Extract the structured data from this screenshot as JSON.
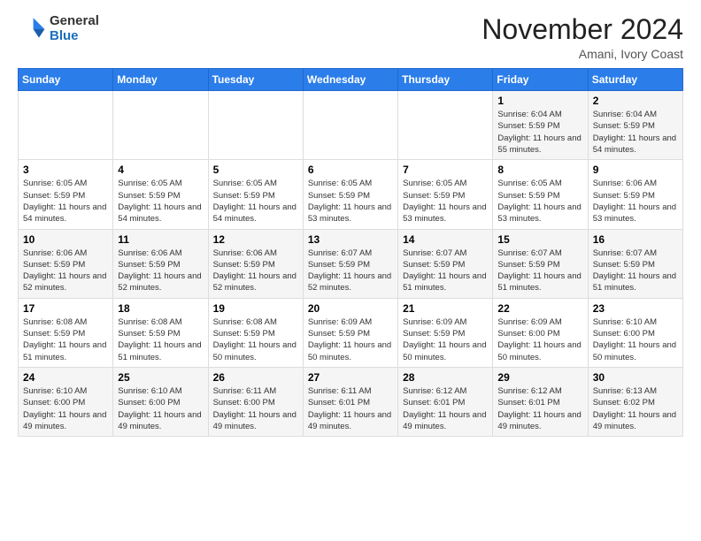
{
  "logo": {
    "line1": "General",
    "line2": "Blue"
  },
  "title": "November 2024",
  "location": "Amani, Ivory Coast",
  "days_of_week": [
    "Sunday",
    "Monday",
    "Tuesday",
    "Wednesday",
    "Thursday",
    "Friday",
    "Saturday"
  ],
  "weeks": [
    [
      {
        "day": "",
        "info": ""
      },
      {
        "day": "",
        "info": ""
      },
      {
        "day": "",
        "info": ""
      },
      {
        "day": "",
        "info": ""
      },
      {
        "day": "",
        "info": ""
      },
      {
        "day": "1",
        "info": "Sunrise: 6:04 AM\nSunset: 5:59 PM\nDaylight: 11 hours and 55 minutes."
      },
      {
        "day": "2",
        "info": "Sunrise: 6:04 AM\nSunset: 5:59 PM\nDaylight: 11 hours and 54 minutes."
      }
    ],
    [
      {
        "day": "3",
        "info": "Sunrise: 6:05 AM\nSunset: 5:59 PM\nDaylight: 11 hours and 54 minutes."
      },
      {
        "day": "4",
        "info": "Sunrise: 6:05 AM\nSunset: 5:59 PM\nDaylight: 11 hours and 54 minutes."
      },
      {
        "day": "5",
        "info": "Sunrise: 6:05 AM\nSunset: 5:59 PM\nDaylight: 11 hours and 54 minutes."
      },
      {
        "day": "6",
        "info": "Sunrise: 6:05 AM\nSunset: 5:59 PM\nDaylight: 11 hours and 53 minutes."
      },
      {
        "day": "7",
        "info": "Sunrise: 6:05 AM\nSunset: 5:59 PM\nDaylight: 11 hours and 53 minutes."
      },
      {
        "day": "8",
        "info": "Sunrise: 6:05 AM\nSunset: 5:59 PM\nDaylight: 11 hours and 53 minutes."
      },
      {
        "day": "9",
        "info": "Sunrise: 6:06 AM\nSunset: 5:59 PM\nDaylight: 11 hours and 53 minutes."
      }
    ],
    [
      {
        "day": "10",
        "info": "Sunrise: 6:06 AM\nSunset: 5:59 PM\nDaylight: 11 hours and 52 minutes."
      },
      {
        "day": "11",
        "info": "Sunrise: 6:06 AM\nSunset: 5:59 PM\nDaylight: 11 hours and 52 minutes."
      },
      {
        "day": "12",
        "info": "Sunrise: 6:06 AM\nSunset: 5:59 PM\nDaylight: 11 hours and 52 minutes."
      },
      {
        "day": "13",
        "info": "Sunrise: 6:07 AM\nSunset: 5:59 PM\nDaylight: 11 hours and 52 minutes."
      },
      {
        "day": "14",
        "info": "Sunrise: 6:07 AM\nSunset: 5:59 PM\nDaylight: 11 hours and 51 minutes."
      },
      {
        "day": "15",
        "info": "Sunrise: 6:07 AM\nSunset: 5:59 PM\nDaylight: 11 hours and 51 minutes."
      },
      {
        "day": "16",
        "info": "Sunrise: 6:07 AM\nSunset: 5:59 PM\nDaylight: 11 hours and 51 minutes."
      }
    ],
    [
      {
        "day": "17",
        "info": "Sunrise: 6:08 AM\nSunset: 5:59 PM\nDaylight: 11 hours and 51 minutes."
      },
      {
        "day": "18",
        "info": "Sunrise: 6:08 AM\nSunset: 5:59 PM\nDaylight: 11 hours and 51 minutes."
      },
      {
        "day": "19",
        "info": "Sunrise: 6:08 AM\nSunset: 5:59 PM\nDaylight: 11 hours and 50 minutes."
      },
      {
        "day": "20",
        "info": "Sunrise: 6:09 AM\nSunset: 5:59 PM\nDaylight: 11 hours and 50 minutes."
      },
      {
        "day": "21",
        "info": "Sunrise: 6:09 AM\nSunset: 5:59 PM\nDaylight: 11 hours and 50 minutes."
      },
      {
        "day": "22",
        "info": "Sunrise: 6:09 AM\nSunset: 6:00 PM\nDaylight: 11 hours and 50 minutes."
      },
      {
        "day": "23",
        "info": "Sunrise: 6:10 AM\nSunset: 6:00 PM\nDaylight: 11 hours and 50 minutes."
      }
    ],
    [
      {
        "day": "24",
        "info": "Sunrise: 6:10 AM\nSunset: 6:00 PM\nDaylight: 11 hours and 49 minutes."
      },
      {
        "day": "25",
        "info": "Sunrise: 6:10 AM\nSunset: 6:00 PM\nDaylight: 11 hours and 49 minutes."
      },
      {
        "day": "26",
        "info": "Sunrise: 6:11 AM\nSunset: 6:00 PM\nDaylight: 11 hours and 49 minutes."
      },
      {
        "day": "27",
        "info": "Sunrise: 6:11 AM\nSunset: 6:01 PM\nDaylight: 11 hours and 49 minutes."
      },
      {
        "day": "28",
        "info": "Sunrise: 6:12 AM\nSunset: 6:01 PM\nDaylight: 11 hours and 49 minutes."
      },
      {
        "day": "29",
        "info": "Sunrise: 6:12 AM\nSunset: 6:01 PM\nDaylight: 11 hours and 49 minutes."
      },
      {
        "day": "30",
        "info": "Sunrise: 6:13 AM\nSunset: 6:02 PM\nDaylight: 11 hours and 49 minutes."
      }
    ]
  ]
}
